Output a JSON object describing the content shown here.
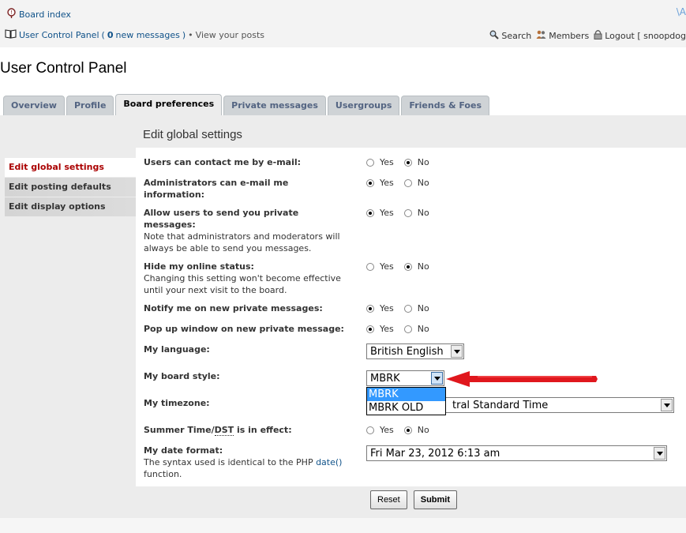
{
  "nav": {
    "board_index": "Board index",
    "ucp_label": "User Control Panel",
    "ucp_paren_open": "(",
    "new_count": "0",
    "new_messages": "new messages",
    "ucp_paren_close": ")",
    "bullet": "•",
    "view_posts": "View your posts"
  },
  "header_links": {
    "search": "Search",
    "members": "Members",
    "logout": "Logout [ snoopdog"
  },
  "page_title": "User Control Panel",
  "tabs": [
    {
      "label": "Overview"
    },
    {
      "label": "Profile"
    },
    {
      "label": "Board preferences"
    },
    {
      "label": "Private messages"
    },
    {
      "label": "Usergroups"
    },
    {
      "label": "Friends & Foes"
    }
  ],
  "sidebar": {
    "items": [
      {
        "label": "Edit global settings"
      },
      {
        "label": "Edit posting defaults"
      },
      {
        "label": "Edit display options"
      }
    ]
  },
  "section_title": "Edit global settings",
  "yes": "Yes",
  "no": "No",
  "fields": {
    "email_contact": {
      "label": "Users can contact me by e-mail:",
      "selected": "No"
    },
    "admin_email": {
      "label": "Administrators can e-mail me information:",
      "selected": "Yes"
    },
    "allow_pm": {
      "label": "Allow users to send you private messages:",
      "explain": "Note that administrators and moderators will always be able to send you messages.",
      "selected": "Yes"
    },
    "hide_online": {
      "label": "Hide my online status:",
      "explain": "Changing this setting won't become effective until your next visit to the board.",
      "selected": "No"
    },
    "notify_pm": {
      "label": "Notify me on new private messages:",
      "selected": "Yes"
    },
    "popup_pm": {
      "label": "Pop up window on new private message:",
      "selected": "Yes"
    },
    "language": {
      "label": "My language:",
      "value": "British English"
    },
    "board_style": {
      "label": "My board style:",
      "value": "MBRK",
      "options": [
        "MBRK",
        "MBRK OLD"
      ],
      "highlighted": "MBRK"
    },
    "timezone": {
      "label": "My timezone:",
      "value_visible": "tral Standard Time"
    },
    "dst": {
      "label_pre": "Summer Time/",
      "label_abbr": "DST",
      "label_post": " is in effect:",
      "selected": "No"
    },
    "date_format": {
      "label": "My date format:",
      "explain_pre": "The syntax used is identical to the PHP ",
      "explain_func": "date()",
      "explain_post": " function.",
      "value": "Fri Mar 23, 2012 6:13 am"
    }
  },
  "buttons": {
    "reset": "Reset",
    "submit": "Submit"
  },
  "colors": {
    "link": "#105289",
    "active_side": "#aa0000",
    "arrow": "#e0171d",
    "listbox_highlight": "#3399ff"
  }
}
